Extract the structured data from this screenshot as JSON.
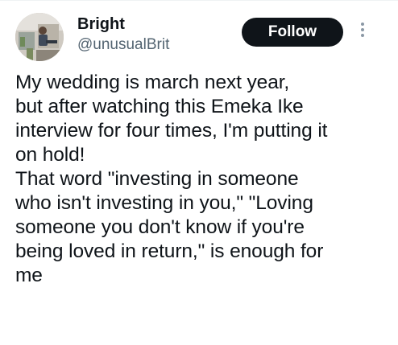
{
  "tweet": {
    "author": {
      "display_name": "Bright",
      "handle": "@unusualBrit",
      "avatar_icon": "profile-photo-person-seated"
    },
    "follow_label": "Follow",
    "more_icon": "vertical-ellipsis-icon",
    "text": "My wedding is march next year,\nbut after watching this Emeka Ike\ninterview for four times, I'm putting it\non hold!\nThat word \"investing in someone\nwho isn't investing in you,\" \"Loving\nsomeone you don't know if you're\nbeing loved in return,\" is enough for\nme"
  },
  "colors": {
    "text": "#0f1419",
    "secondary_text": "#536471",
    "follow_bg": "#0f1419",
    "follow_fg": "#ffffff",
    "menu_dots": "#8b98a5"
  }
}
